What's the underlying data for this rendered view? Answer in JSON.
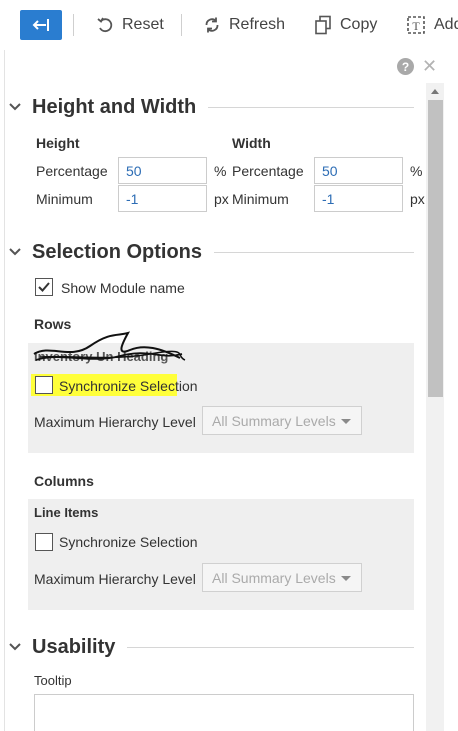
{
  "toolbar": {
    "back_icon": "collapse-arrow-icon",
    "reset_label": "Reset",
    "refresh_label": "Refresh",
    "copy_label": "Copy",
    "add_label": "Add",
    "accent_color": "#2a7dd0"
  },
  "panel": {
    "help_glyph": "?",
    "close_glyph": "✕"
  },
  "height_width": {
    "title": "Height and Width",
    "height_heading": "Height",
    "width_heading": "Width",
    "height_percentage_label": "Percentage",
    "height_percentage_value": "50",
    "height_percentage_unit": "%",
    "height_minimum_label": "Minimum",
    "height_minimum_value": "-1",
    "height_minimum_unit": "px",
    "width_percentage_label": "Percentage",
    "width_percentage_value": "50",
    "width_percentage_unit": "%",
    "width_minimum_label": "Minimum",
    "width_minimum_value": "-1",
    "width_minimum_unit": "px"
  },
  "selection": {
    "title": "Selection Options",
    "show_module_name_label": "Show Module name",
    "show_module_name_checked": true,
    "rows_heading": "Rows",
    "rows_group": {
      "title": "Inventory Un Heading",
      "sync_label": "Synchronize Selection",
      "sync_checked": false,
      "max_level_label": "Maximum Hierarchy Level",
      "max_level_value": "All Summary Levels"
    },
    "columns_heading": "Columns",
    "columns_group": {
      "title": "Line Items",
      "sync_label": "Synchronize Selection",
      "sync_checked": false,
      "max_level_label": "Maximum Hierarchy Level",
      "max_level_value": "All Summary Levels"
    }
  },
  "usability": {
    "title": "Usability",
    "tooltip_label": "Tooltip"
  }
}
